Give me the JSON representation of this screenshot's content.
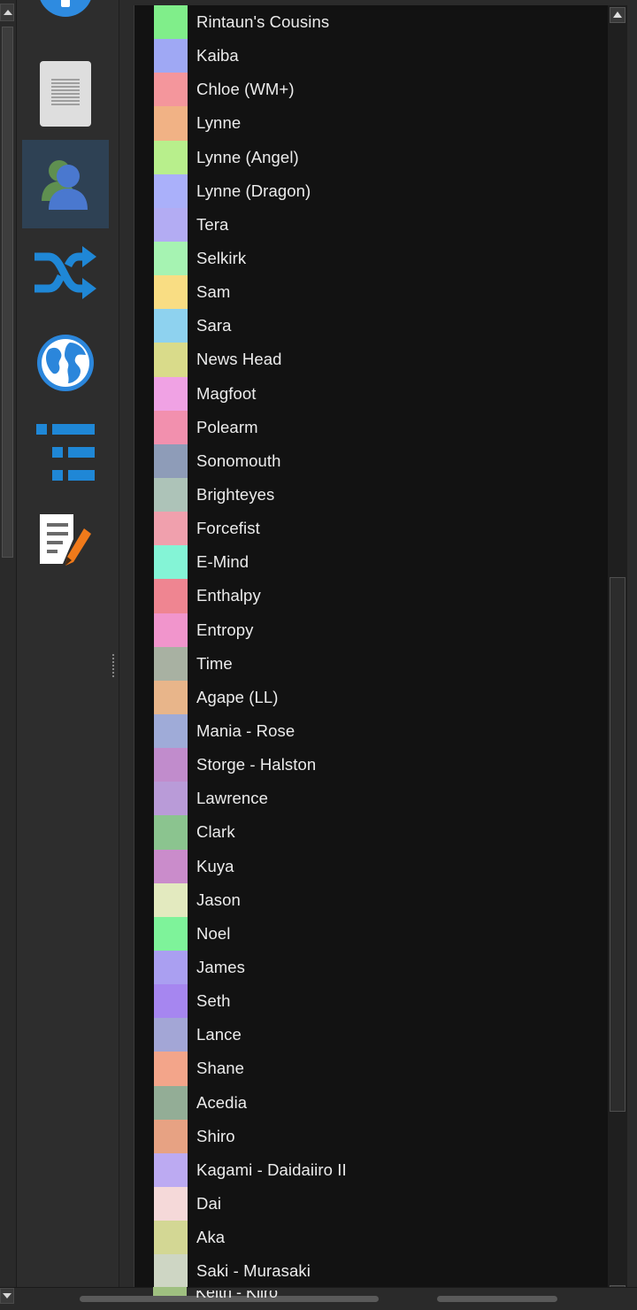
{
  "sidebar": {
    "buttons": [
      {
        "name": "info",
        "icon": "info-icon",
        "color": "#2e8be0"
      },
      {
        "name": "document",
        "icon": "document-icon",
        "color": "#dcdcdc"
      },
      {
        "name": "characters",
        "icon": "users-icon",
        "color": "#5a8ec8",
        "active": true
      },
      {
        "name": "shuffle",
        "icon": "shuffle-icon",
        "color": "#1f87d6"
      },
      {
        "name": "globe",
        "icon": "globe-icon",
        "color": "#2b86db"
      },
      {
        "name": "list",
        "icon": "list-icon",
        "color": "#1f87d6"
      },
      {
        "name": "notes",
        "icon": "edit-document-icon",
        "color": "#f07a1a"
      }
    ]
  },
  "characters": [
    {
      "name": "Rintaun's Cousins",
      "color": "#80ee8a"
    },
    {
      "name": "Kaiba",
      "color": "#9fa8f4"
    },
    {
      "name": "Chloe (WM+)",
      "color": "#f4969c"
    },
    {
      "name": "Lynne",
      "color": "#f1b285"
    },
    {
      "name": "Lynne (Angel)",
      "color": "#b8ef8c"
    },
    {
      "name": "Lynne (Dragon)",
      "color": "#aab0fa"
    },
    {
      "name": "Tera",
      "color": "#b3acf3"
    },
    {
      "name": "Selkirk",
      "color": "#a6f3b2"
    },
    {
      "name": "Sam",
      "color": "#f9dd83"
    },
    {
      "name": "Sara",
      "color": "#8ed2ef"
    },
    {
      "name": "News Head",
      "color": "#d9db8a"
    },
    {
      "name": "Magfoot",
      "color": "#f0a2e4"
    },
    {
      "name": "Polearm",
      "color": "#f290ae"
    },
    {
      "name": "Sonomouth",
      "color": "#8e9cb8"
    },
    {
      "name": "Brighteyes",
      "color": "#adc3b8"
    },
    {
      "name": "Forcefist",
      "color": "#f0a0ad"
    },
    {
      "name": "E-Mind",
      "color": "#84f4d6"
    },
    {
      "name": "Enthalpy",
      "color": "#ef8591"
    },
    {
      "name": "Entropy",
      "color": "#f195cc"
    },
    {
      "name": "Time",
      "color": "#a8b1a2"
    },
    {
      "name": "Agape (LL)",
      "color": "#e8b58a"
    },
    {
      "name": "Mania - Rose",
      "color": "#9fabd8"
    },
    {
      "name": "Storge - Halston",
      "color": "#c18ccc"
    },
    {
      "name": "Lawrence",
      "color": "#b99bd8"
    },
    {
      "name": "Clark",
      "color": "#8bc48f"
    },
    {
      "name": "Kuya",
      "color": "#ca8ccb"
    },
    {
      "name": "Jason",
      "color": "#e3eabf"
    },
    {
      "name": "Noel",
      "color": "#7ef39a"
    },
    {
      "name": "James",
      "color": "#aa9ff1"
    },
    {
      "name": "Seth",
      "color": "#a686f0"
    },
    {
      "name": "Lance",
      "color": "#a3a6d6"
    },
    {
      "name": "Shane",
      "color": "#f3a58a"
    },
    {
      "name": "Acedia",
      "color": "#93ad96"
    },
    {
      "name": "Shiro",
      "color": "#e7a283"
    },
    {
      "name": "Kagami - Daidaiiro II",
      "color": "#bcaaf2"
    },
    {
      "name": "Dai",
      "color": "#f5d9d9"
    },
    {
      "name": "Aka",
      "color": "#d3d794"
    },
    {
      "name": "Saki - Murasaki",
      "color": "#ced6c4"
    }
  ],
  "partial_row_label": "Keith - Kiiro"
}
